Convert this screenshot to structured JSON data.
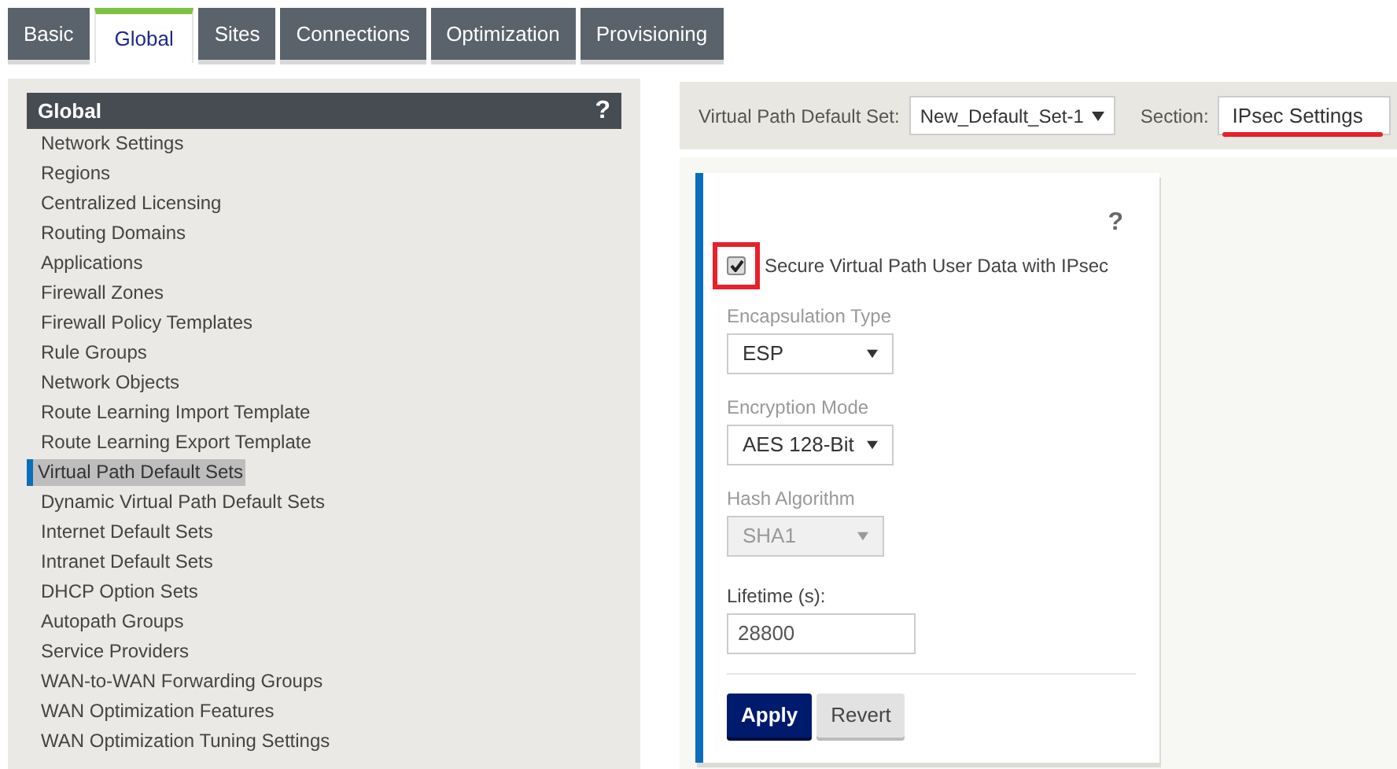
{
  "tabs": [
    {
      "label": "Basic",
      "selected": false
    },
    {
      "label": "Global",
      "selected": true
    },
    {
      "label": "Sites",
      "selected": false
    },
    {
      "label": "Connections",
      "selected": false
    },
    {
      "label": "Optimization",
      "selected": false
    },
    {
      "label": "Provisioning",
      "selected": false
    }
  ],
  "sidebar": {
    "title": "Global",
    "help": "?",
    "items": [
      {
        "label": "Network Settings",
        "selected": false
      },
      {
        "label": "Regions",
        "selected": false
      },
      {
        "label": "Centralized Licensing",
        "selected": false
      },
      {
        "label": "Routing Domains",
        "selected": false
      },
      {
        "label": "Applications",
        "selected": false
      },
      {
        "label": "Firewall Zones",
        "selected": false
      },
      {
        "label": "Firewall Policy Templates",
        "selected": false
      },
      {
        "label": "Rule Groups",
        "selected": false
      },
      {
        "label": "Network Objects",
        "selected": false
      },
      {
        "label": "Route Learning Import Template",
        "selected": false
      },
      {
        "label": "Route Learning Export Template",
        "selected": false
      },
      {
        "label": "Virtual Path Default Sets",
        "selected": true
      },
      {
        "label": "Dynamic Virtual Path Default Sets",
        "selected": false
      },
      {
        "label": "Internet Default Sets",
        "selected": false
      },
      {
        "label": "Intranet Default Sets",
        "selected": false
      },
      {
        "label": "DHCP Option Sets",
        "selected": false
      },
      {
        "label": "Autopath Groups",
        "selected": false
      },
      {
        "label": "Service Providers",
        "selected": false
      },
      {
        "label": "WAN-to-WAN Forwarding Groups",
        "selected": false
      },
      {
        "label": "WAN Optimization Features",
        "selected": false
      },
      {
        "label": "WAN Optimization Tuning Settings",
        "selected": false
      }
    ]
  },
  "toolbar": {
    "set_label": "Virtual Path Default Set:",
    "set_value": "New_Default_Set-1",
    "section_label": "Section:",
    "section_value": "IPsec Settings"
  },
  "form": {
    "help": "?",
    "checkbox": {
      "label": "Secure Virtual Path User Data with IPsec",
      "checked": true
    },
    "fields": [
      {
        "label": "Encapsulation Type",
        "value": "ESP",
        "disabled": false
      },
      {
        "label": "Encryption Mode",
        "value": "AES 128-Bit",
        "disabled": false
      },
      {
        "label": "Hash Algorithm",
        "value": "SHA1",
        "disabled": true
      }
    ],
    "lifetime": {
      "label": "Lifetime (s):",
      "value": "28800"
    },
    "buttons": [
      "Apply",
      "Revert"
    ]
  }
}
